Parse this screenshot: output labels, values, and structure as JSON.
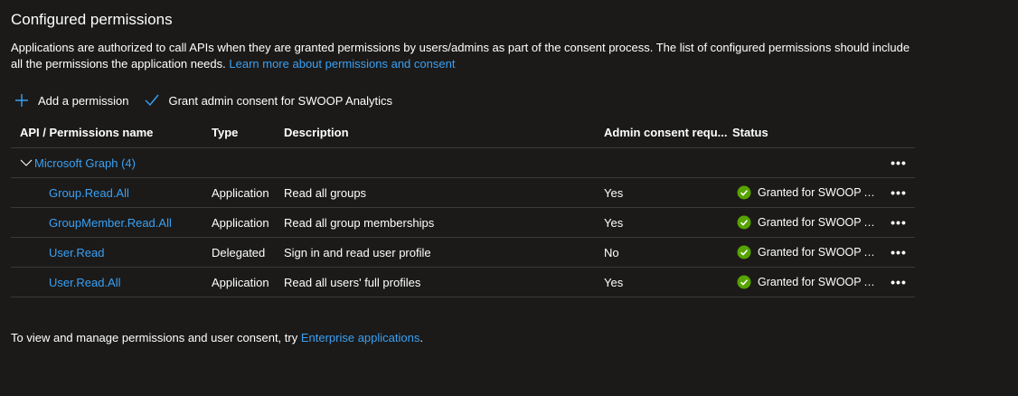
{
  "section": {
    "title": "Configured permissions",
    "description": "Applications are authorized to call APIs when they are granted permissions by users/admins as part of the consent process. The list of configured permissions should include all the permissions the application needs.",
    "learn_more_link": "Learn more about permissions and consent"
  },
  "toolbar": {
    "add_label": "Add a permission",
    "grant_label": "Grant admin consent for SWOOP Analytics"
  },
  "table": {
    "headers": {
      "name": "API / Permissions name",
      "type": "Type",
      "description": "Description",
      "admin": "Admin consent requ...",
      "status": "Status"
    },
    "group": {
      "label": "Microsoft Graph (4)"
    },
    "rows": [
      {
        "name": "Group.Read.All",
        "type": "Application",
        "description": "Read all groups",
        "admin": "Yes",
        "status": "Granted for SWOOP An..."
      },
      {
        "name": "GroupMember.Read.All",
        "type": "Application",
        "description": "Read all group memberships",
        "admin": "Yes",
        "status": "Granted for SWOOP An..."
      },
      {
        "name": "User.Read",
        "type": "Delegated",
        "description": "Sign in and read user profile",
        "admin": "No",
        "status": "Granted for SWOOP An..."
      },
      {
        "name": "User.Read.All",
        "type": "Application",
        "description": "Read all users' full profiles",
        "admin": "Yes",
        "status": "Granted for SWOOP An..."
      }
    ],
    "more_label": "•••"
  },
  "footer": {
    "text": "To view and manage permissions and user consent, try ",
    "link": "Enterprise applications",
    "suffix": "."
  },
  "colors": {
    "background": "#1b1a19",
    "link": "#3aa0f3",
    "success": "#57a300",
    "divider": "#3b3a39"
  },
  "icons": {
    "add": "plus-icon",
    "grant": "checkmark-icon",
    "group_toggle": "chevron-down-icon",
    "status": "success-check-icon",
    "more": "more-icon"
  }
}
